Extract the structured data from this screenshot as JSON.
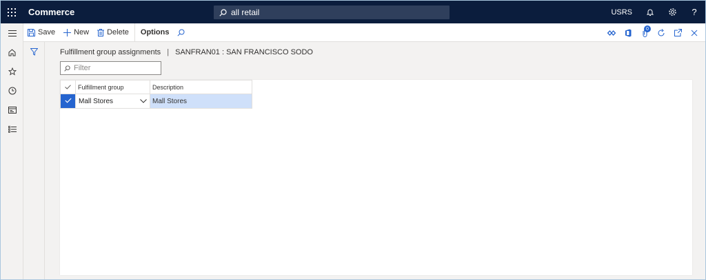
{
  "app": {
    "title": "Commerce",
    "search_value": "all retail",
    "company": "USRS"
  },
  "toolbar": {
    "save_label": "Save",
    "new_label": "New",
    "delete_label": "Delete",
    "options_label": "Options",
    "notification_count": "0"
  },
  "breadcrumb": {
    "page": "Fulfillment group assignments",
    "separator": "|",
    "record": "SANFRAN01 : SAN FRANCISCO SODO"
  },
  "filter": {
    "placeholder": "Filter"
  },
  "grid": {
    "columns": [
      "Fulfillment group",
      "Description"
    ],
    "rows": [
      {
        "fulfillment_group": "Mall Stores",
        "description": "Mall Stores",
        "selected": true
      }
    ]
  },
  "colors": {
    "topbar": "#0b1d3d",
    "accent": "#2564cf",
    "selected_row": "#cfe0fa"
  }
}
